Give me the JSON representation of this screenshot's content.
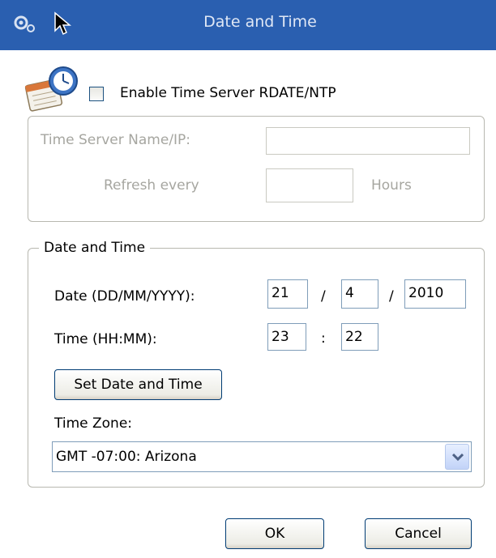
{
  "window": {
    "title": "Date and Time"
  },
  "ntp": {
    "enable_label": "Enable Time Server RDATE/NTP",
    "enabled": false,
    "server_label": "Time Server Name/IP:",
    "server_value": "",
    "refresh_label": "Refresh every",
    "refresh_value": "",
    "hours_label": "Hours"
  },
  "datetime": {
    "group_label": "Date and Time",
    "date_label": "Date (DD/MM/YYYY):",
    "day": "21",
    "month": "4",
    "year": "2010",
    "date_sep": "/",
    "time_label": "Time (HH:MM):",
    "hour": "23",
    "minute": "22",
    "time_sep": ":",
    "set_button": "Set Date and Time",
    "timezone_label": "Time Zone:",
    "timezone_value": "GMT -07:00: Arizona"
  },
  "buttons": {
    "ok": "OK",
    "cancel": "Cancel"
  },
  "icons": {
    "titlebar": "gears-icon",
    "cursor": "mouse-cursor-icon",
    "app": "calendar-clock-icon",
    "dropdown": "chevron-down-icon"
  },
  "colors": {
    "titlebar": "#2a5fb0",
    "title_text": "#dfe7f5",
    "disabled_text": "#a6a6a0"
  }
}
